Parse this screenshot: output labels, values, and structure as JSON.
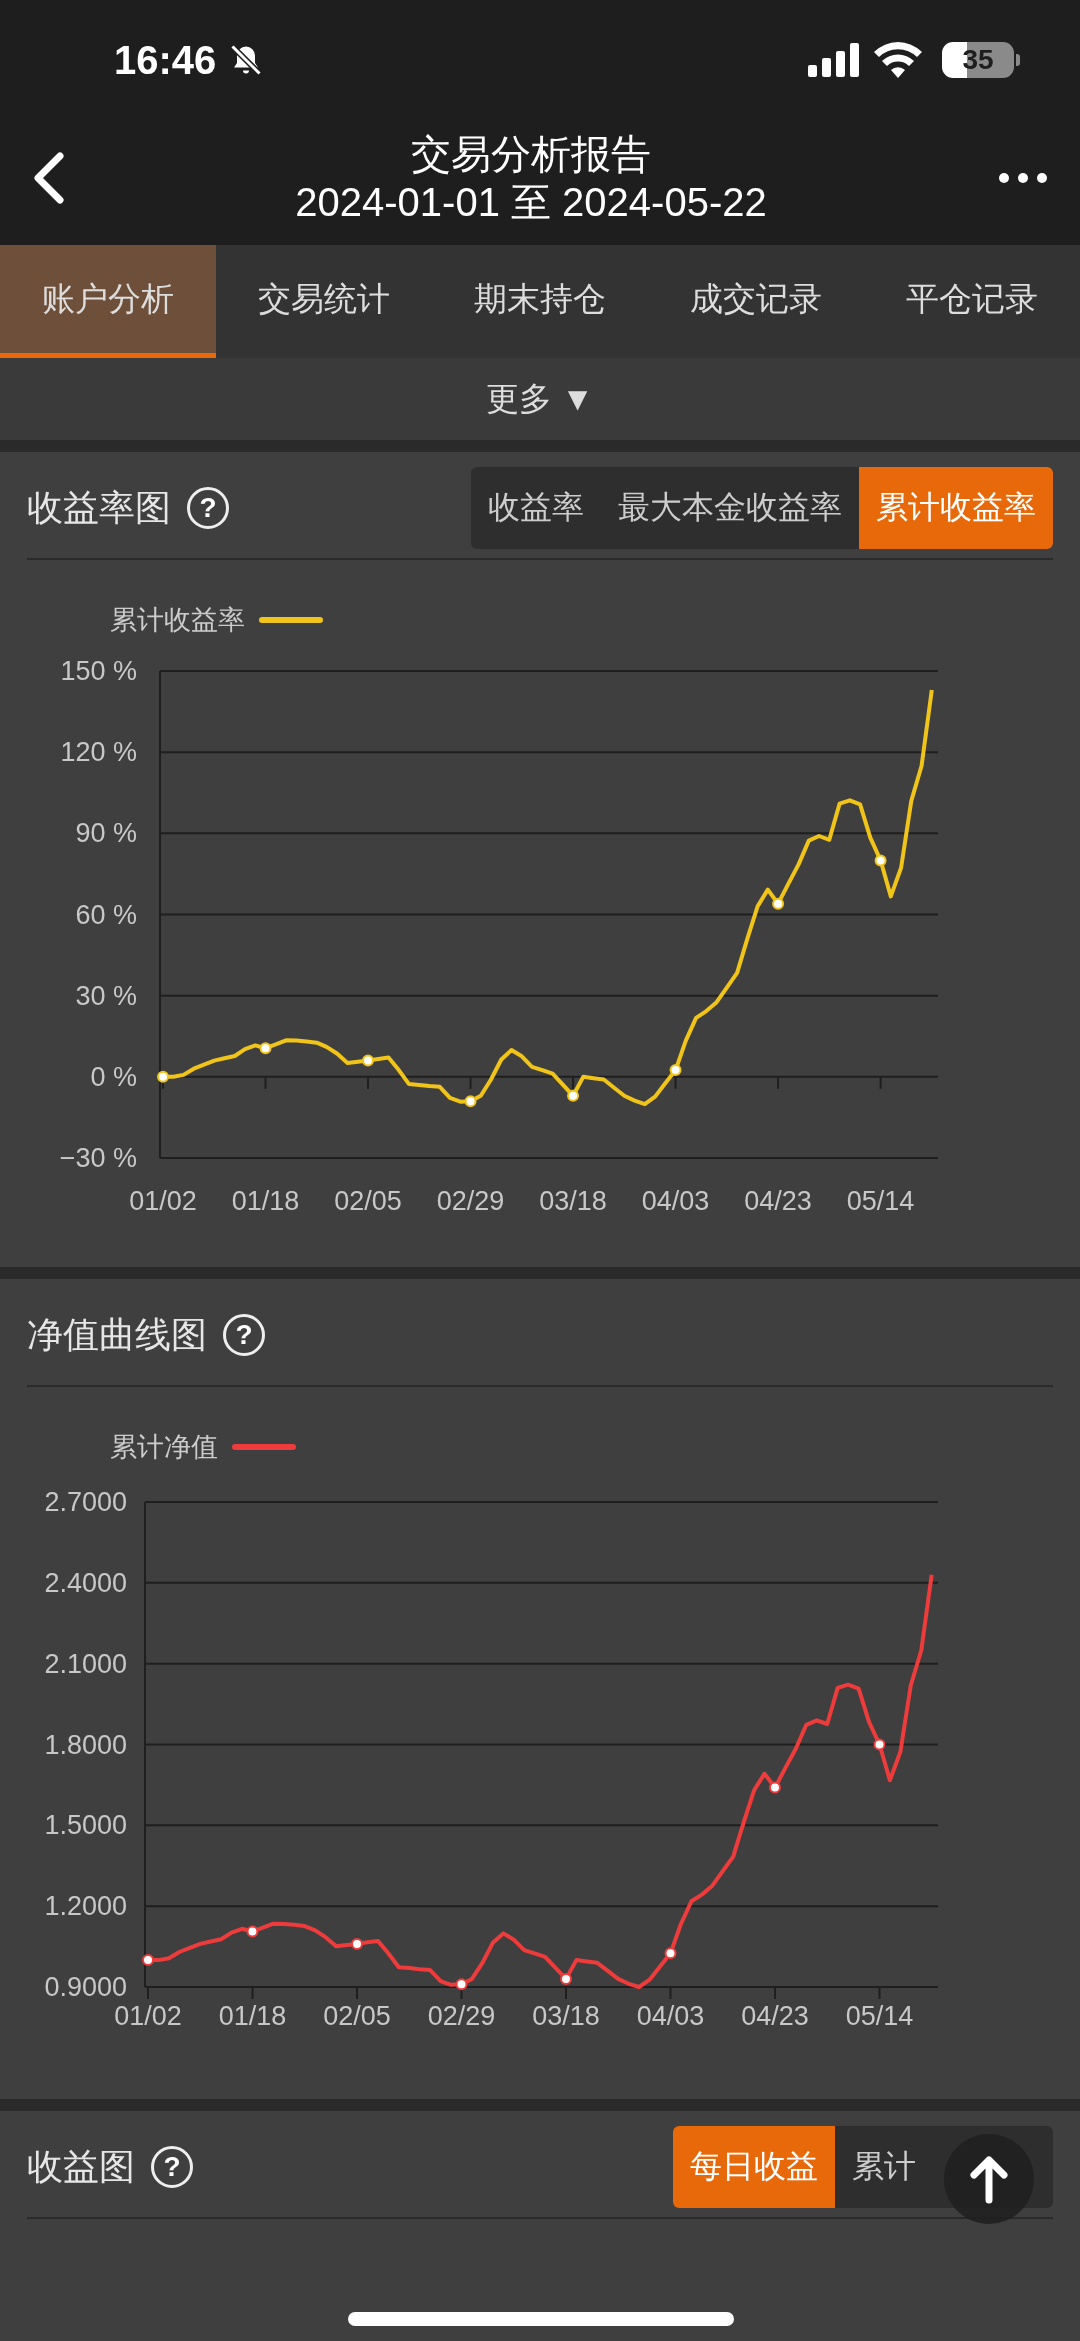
{
  "status_bar": {
    "time": "16:46",
    "battery": "35"
  },
  "header": {
    "title": "交易分析报告",
    "subtitle": "2024-01-01 至 2024-05-22"
  },
  "tabs": [
    {
      "label": "账户分析",
      "selected": true
    },
    {
      "label": "交易统计",
      "selected": false
    },
    {
      "label": "期末持仓",
      "selected": false
    },
    {
      "label": "成交记录",
      "selected": false
    },
    {
      "label": "平仓记录",
      "selected": false
    }
  ],
  "more": {
    "label": "更多",
    "glyph": "▼"
  },
  "sections": [
    {
      "title": "收益率图",
      "help": "?",
      "segments": [
        {
          "label": "收益率",
          "selected": false
        },
        {
          "label": "最大本金收益率",
          "selected": false
        },
        {
          "label": "累计收益率",
          "selected": true
        }
      ],
      "chart_data": {
        "type": "line",
        "categories": [
          "01/02",
          null,
          null,
          null,
          null,
          null,
          null,
          null,
          null,
          null,
          "01/18",
          null,
          null,
          null,
          null,
          null,
          null,
          null,
          null,
          null,
          "02/05",
          null,
          null,
          null,
          null,
          null,
          null,
          null,
          null,
          null,
          "02/29",
          null,
          null,
          null,
          null,
          null,
          null,
          null,
          null,
          null,
          "03/18",
          null,
          null,
          null,
          null,
          null,
          null,
          null,
          null,
          null,
          "04/03",
          null,
          null,
          null,
          null,
          null,
          null,
          null,
          null,
          null,
          "04/23",
          null,
          null,
          null,
          null,
          null,
          null,
          null,
          null,
          null,
          "05/14",
          null,
          null,
          null,
          null,
          null
        ],
        "series": [
          {
            "name": "累计收益率",
            "color": "#f0c419",
            "values": [
              0,
              0,
              0.7,
              3,
              4.5,
              6,
              6.9,
              7.7,
              10.2,
              11.6,
              10.6,
              12,
              13.5,
              13.4,
              13.1,
              12.6,
              11,
              8.5,
              5.1,
              5.6,
              6,
              6.6,
              7.1,
              2.5,
              -2.7,
              -3,
              -3.4,
              -3.7,
              -7.8,
              -9.2,
              -9,
              -7,
              -1,
              6.4,
              9.9,
              7.6,
              3.7,
              2.5,
              1.2,
              -2.9,
              -7,
              0,
              -0.5,
              -1,
              -4,
              -7,
              -8.8,
              -10.1,
              -7.3,
              -2.4,
              2.5,
              13.4,
              21.8,
              24.3,
              27.6,
              33,
              38.4,
              51,
              63,
              69.2,
              64,
              71.3,
              78.5,
              87.3,
              89,
              87.6,
              101,
              102.2,
              100.7,
              88.4,
              80,
              66.7,
              77.3,
              102,
              115,
              143
            ]
          }
        ],
        "ylim": [
          -30,
          150
        ],
        "grid": true,
        "yticks": [
          {
            "value": 150,
            "label": "150 %"
          },
          {
            "value": 120,
            "label": "120 %"
          },
          {
            "value": 90,
            "label": "90 %"
          },
          {
            "value": 60,
            "label": "60 %"
          },
          {
            "value": 30,
            "label": "30 %"
          },
          {
            "value": 0,
            "label": "0 %"
          },
          {
            "value": -30,
            "label": "−30 %"
          }
        ]
      }
    },
    {
      "title": "净值曲线图",
      "help": "?",
      "chart_data": {
        "type": "line",
        "categories": [
          "01/02",
          null,
          null,
          null,
          null,
          null,
          null,
          null,
          null,
          null,
          "01/18",
          null,
          null,
          null,
          null,
          null,
          null,
          null,
          null,
          null,
          "02/05",
          null,
          null,
          null,
          null,
          null,
          null,
          null,
          null,
          null,
          "02/29",
          null,
          null,
          null,
          null,
          null,
          null,
          null,
          null,
          null,
          "03/18",
          null,
          null,
          null,
          null,
          null,
          null,
          null,
          null,
          null,
          "04/03",
          null,
          null,
          null,
          null,
          null,
          null,
          null,
          null,
          null,
          "04/23",
          null,
          null,
          null,
          null,
          null,
          null,
          null,
          null,
          null,
          "05/14",
          null,
          null,
          null,
          null,
          null
        ],
        "series": [
          {
            "name": "累计净值",
            "color": "#ee3b3b",
            "values": [
              1,
              1,
              1.007,
              1.03,
              1.045,
              1.06,
              1.069,
              1.077,
              1.102,
              1.116,
              1.106,
              1.12,
              1.135,
              1.134,
              1.131,
              1.126,
              1.11,
              1.085,
              1.051,
              1.056,
              1.06,
              1.066,
              1.071,
              1.025,
              0.973,
              0.97,
              0.966,
              0.963,
              0.922,
              0.908,
              0.91,
              0.93,
              0.99,
              1.064,
              1.099,
              1.076,
              1.037,
              1.025,
              1.012,
              0.971,
              0.93,
              1,
              0.995,
              0.99,
              0.96,
              0.93,
              0.912,
              0.9,
              0.927,
              0.976,
              1.025,
              1.134,
              1.218,
              1.243,
              1.276,
              1.33,
              1.384,
              1.51,
              1.63,
              1.692,
              1.64,
              1.713,
              1.785,
              1.873,
              1.89,
              1.876,
              2.01,
              2.022,
              2.007,
              1.884,
              1.8,
              1.667,
              1.773,
              2.02,
              2.15,
              2.43
            ]
          }
        ],
        "ylim": [
          0.9,
          2.7
        ],
        "grid": true,
        "yticks": [
          {
            "value": 2.7,
            "label": "2.7000"
          },
          {
            "value": 2.4,
            "label": "2.4000"
          },
          {
            "value": 2.1,
            "label": "2.1000"
          },
          {
            "value": 1.8,
            "label": "1.8000"
          },
          {
            "value": 1.5,
            "label": "1.5000"
          },
          {
            "value": 1.2,
            "label": "1.2000"
          },
          {
            "value": 0.9,
            "label": "0.9000"
          }
        ]
      }
    },
    {
      "title": "收益图",
      "help": "?",
      "segments": [
        {
          "label": "每日收益",
          "selected": true
        },
        {
          "label": "累计",
          "selected": false
        }
      ]
    }
  ]
}
